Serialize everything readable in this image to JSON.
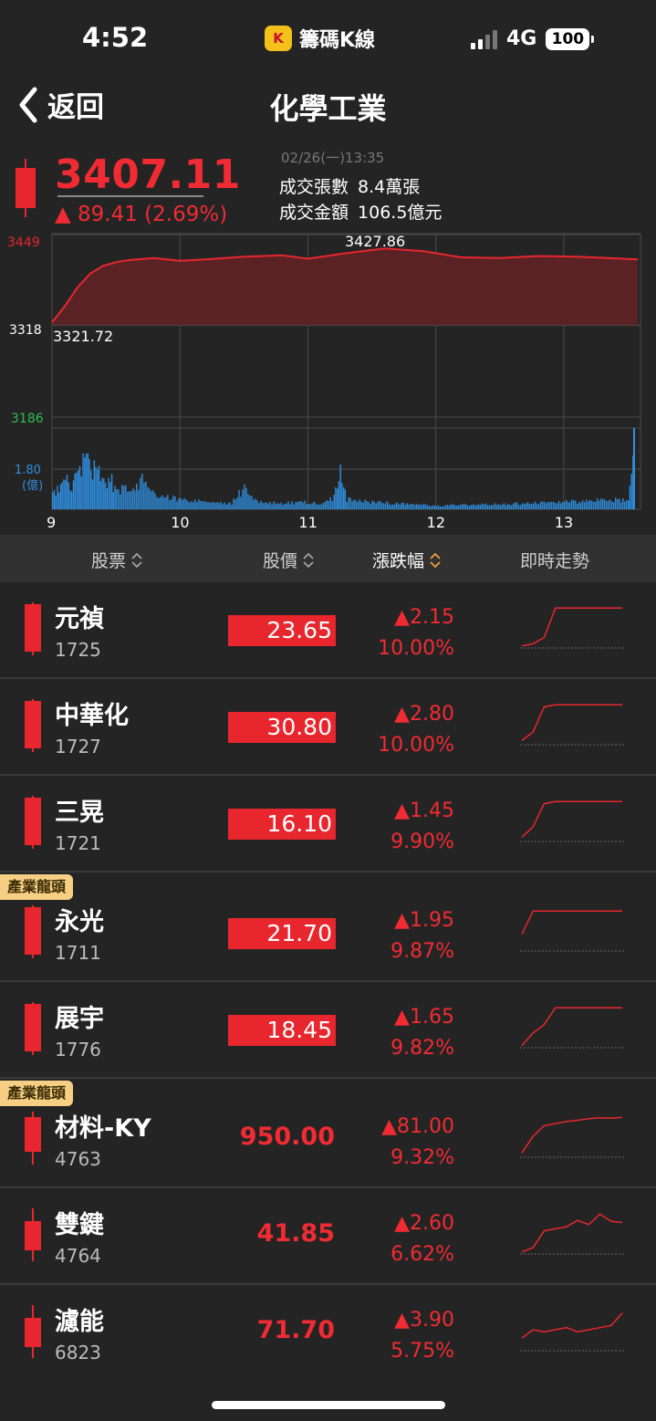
{
  "status": {
    "time": "4:52",
    "app_logo": "K",
    "app_name": "籌碼K線",
    "network": "4G",
    "battery": "100"
  },
  "nav": {
    "back_label": "返回",
    "title": "化學工業"
  },
  "index": {
    "price": "3407.11",
    "change": "▲ 89.41 (2.69%)",
    "datetime": "02/26(一)13:35",
    "volume_label": "成交張數",
    "volume_value": "8.4萬張",
    "amount_label": "成交金額",
    "amount_value": "106.5億元"
  },
  "chart_data": {
    "type": "line",
    "price_series": {
      "x": [
        9.0,
        9.1,
        9.2,
        9.3,
        9.4,
        9.5,
        9.6,
        9.8,
        10.0,
        10.2,
        10.5,
        10.8,
        11.0,
        11.3,
        11.6,
        11.9,
        12.2,
        12.5,
        12.8,
        13.1,
        13.35,
        13.58
      ],
      "y": [
        3321.72,
        3345,
        3372,
        3392,
        3403,
        3408,
        3411,
        3414,
        3410,
        3412,
        3416,
        3418,
        3413,
        3421,
        3427.86,
        3424,
        3415,
        3414,
        3417,
        3416,
        3414,
        3412
      ]
    },
    "volume_series": {
      "x": [
        9.0,
        9.05,
        9.1,
        9.15,
        9.2,
        9.25,
        9.3,
        9.35,
        9.4,
        9.45,
        9.5,
        9.6,
        9.7,
        9.8,
        9.9,
        10.0,
        10.2,
        10.4,
        10.5,
        10.6,
        10.8,
        11.0,
        11.1,
        11.2,
        11.25,
        11.3,
        11.5,
        11.8,
        12.0,
        12.5,
        13.0,
        13.2,
        13.5,
        13.55
      ],
      "y": [
        0.6,
        0.9,
        1.2,
        0.9,
        1.5,
        2.1,
        1.6,
        1.8,
        1.0,
        1.3,
        0.7,
        0.9,
        1.2,
        0.6,
        0.5,
        0.4,
        0.3,
        0.25,
        0.9,
        0.3,
        0.25,
        0.3,
        0.2,
        0.5,
        1.5,
        0.4,
        0.3,
        0.2,
        0.15,
        0.2,
        0.3,
        0.35,
        0.4,
        2.6
      ]
    },
    "y_ticks": [
      "3449",
      "3318",
      "3186"
    ],
    "ylim": [
      3186,
      3449
    ],
    "open_label": "3321.72",
    "high_label": "3427.86",
    "volume_tick": "1.80",
    "volume_unit": "(億)",
    "vol_ylim": [
      0,
      2.6
    ],
    "x_ticks": [
      "9",
      "10",
      "11",
      "12",
      "13"
    ],
    "xlim": [
      9,
      13.6
    ],
    "grid": true,
    "colors": {
      "line": "#e8262e",
      "fill": "#5a2224",
      "volume": "#2f8fe0",
      "up_tick": "#e8262e",
      "down_tick": "#2fbd4e",
      "vol_tick": "#2f8fe0"
    }
  },
  "list_header": {
    "stock": "股票",
    "price": "股價",
    "change": "漲跌幅",
    "trend": "即時走勢"
  },
  "rows": [
    {
      "name": "元禎",
      "code": "1725",
      "price": "23.65",
      "limit": true,
      "change": "▲2.15",
      "percent": "10.00%",
      "tag": "",
      "trend": [
        0.05,
        0.1,
        0.25,
        0.95,
        0.95,
        0.95,
        0.95,
        0.95,
        0.95,
        0.95
      ]
    },
    {
      "name": "中華化",
      "code": "1727",
      "price": "30.80",
      "limit": true,
      "change": "▲2.80",
      "percent": "10.00%",
      "tag": "",
      "trend": [
        0.1,
        0.3,
        0.9,
        0.95,
        0.95,
        0.95,
        0.95,
        0.95,
        0.95,
        0.95
      ]
    },
    {
      "name": "三晃",
      "code": "1721",
      "price": "16.10",
      "limit": true,
      "change": "▲1.45",
      "percent": "9.90%",
      "tag": "",
      "trend": [
        0.1,
        0.35,
        0.9,
        0.95,
        0.95,
        0.95,
        0.95,
        0.95,
        0.95,
        0.95
      ]
    },
    {
      "name": "永光",
      "code": "1711",
      "price": "21.70",
      "limit": true,
      "change": "▲1.95",
      "percent": "9.87%",
      "tag": "產業龍頭",
      "trend": [
        0.4,
        0.95,
        0.95,
        0.95,
        0.95,
        0.95,
        0.95,
        0.95,
        0.95,
        0.95
      ]
    },
    {
      "name": "展宇",
      "code": "1776",
      "price": "18.45",
      "limit": true,
      "change": "▲1.65",
      "percent": "9.82%",
      "tag": "",
      "trend": [
        0.05,
        0.35,
        0.55,
        0.95,
        0.95,
        0.95,
        0.95,
        0.95,
        0.95,
        0.95
      ]
    },
    {
      "name": "材料-KY",
      "code": "4763",
      "price": "950.00",
      "limit": false,
      "change": "▲81.00",
      "percent": "9.32%",
      "tag": "產業龍頭",
      "trend": [
        0.1,
        0.5,
        0.75,
        0.8,
        0.85,
        0.88,
        0.92,
        0.94,
        0.93,
        0.95
      ]
    },
    {
      "name": "雙鍵",
      "code": "4764",
      "price": "41.85",
      "limit": false,
      "change": "▲2.60",
      "percent": "6.62%",
      "tag": "",
      "trend": [
        0.05,
        0.15,
        0.55,
        0.6,
        0.65,
        0.8,
        0.7,
        0.95,
        0.78,
        0.75
      ]
    },
    {
      "name": "濾能",
      "code": "6823",
      "price": "71.70",
      "limit": false,
      "change": "▲3.90",
      "percent": "5.75%",
      "tag": "",
      "trend": [
        0.3,
        0.5,
        0.45,
        0.5,
        0.55,
        0.45,
        0.5,
        0.55,
        0.6,
        0.9
      ]
    }
  ]
}
